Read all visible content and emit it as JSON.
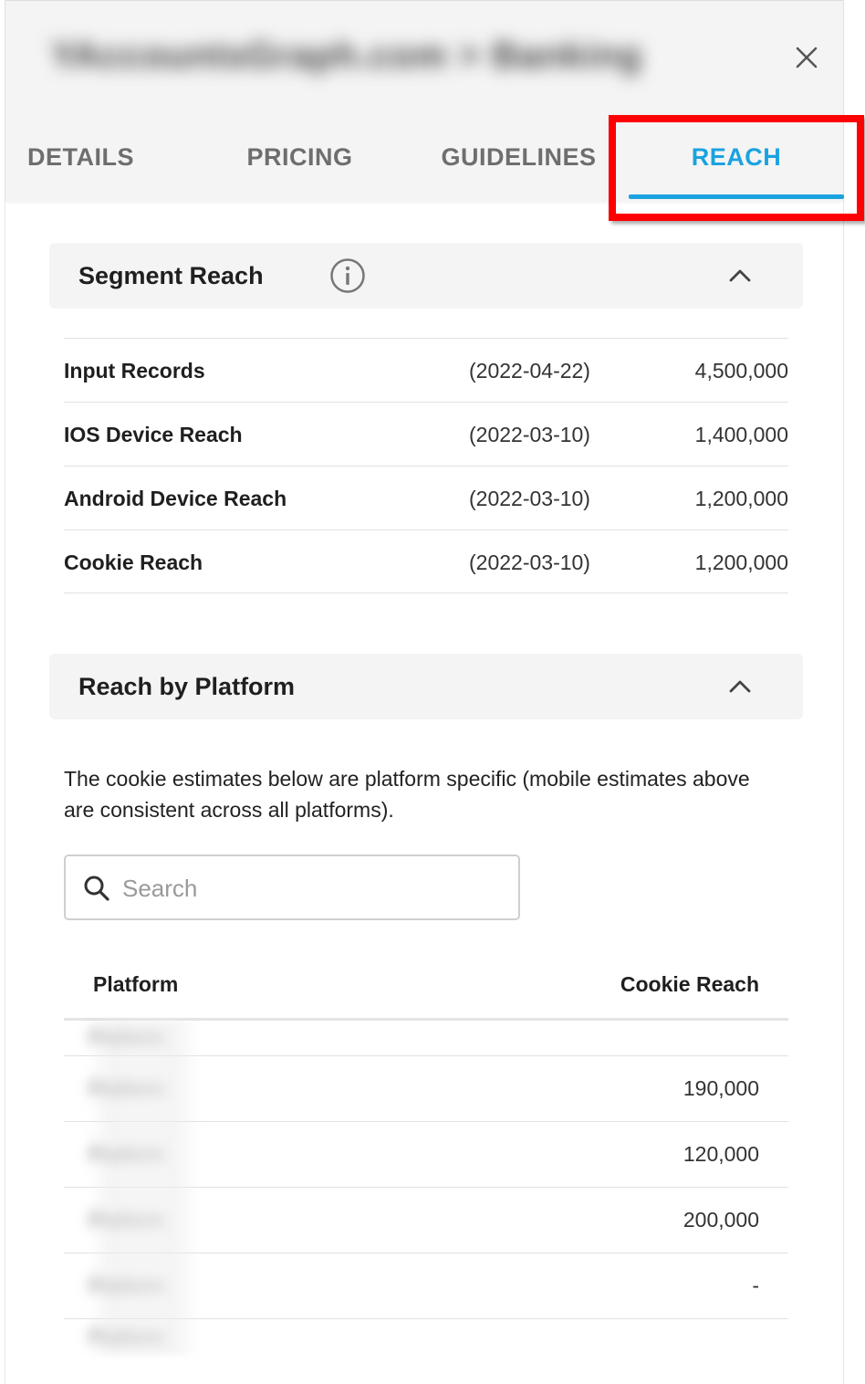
{
  "header": {
    "title": "YAccountsGraph.com > Banking"
  },
  "tabs": [
    {
      "label": "DETAILS",
      "active": false
    },
    {
      "label": "PRICING",
      "active": false
    },
    {
      "label": "GUIDELINES",
      "active": false
    },
    {
      "label": "REACH",
      "active": true
    }
  ],
  "colors": {
    "accent": "#1aa3e0",
    "highlight": "#ff0000",
    "section_bg": "#f4f4f4"
  },
  "segment_reach": {
    "title": "Segment Reach",
    "rows": [
      {
        "name": "Input Records",
        "date": "(2022-04-22)",
        "value": "4,500,000"
      },
      {
        "name": "IOS Device Reach",
        "date": "(2022-03-10)",
        "value": "1,400,000"
      },
      {
        "name": "Android Device Reach",
        "date": "(2022-03-10)",
        "value": "1,200,000"
      },
      {
        "name": "Cookie Reach",
        "date": "(2022-03-10)",
        "value": "1,200,000"
      }
    ]
  },
  "reach_by_platform": {
    "title": "Reach by Platform",
    "description": "The cookie estimates below are platform specific (mobile estimates above are consistent across all platforms).",
    "search_placeholder": "Search",
    "columns": {
      "platform": "Platform",
      "cookie_reach": "Cookie Reach"
    },
    "rows": [
      {
        "platform": "Platform",
        "value": ""
      },
      {
        "platform": "Platform",
        "value": "190,000"
      },
      {
        "platform": "Platform",
        "value": "120,000"
      },
      {
        "platform": "Platform",
        "value": "200,000"
      },
      {
        "platform": "Platform",
        "value": "-"
      },
      {
        "platform": "Platform",
        "value": ""
      }
    ]
  }
}
